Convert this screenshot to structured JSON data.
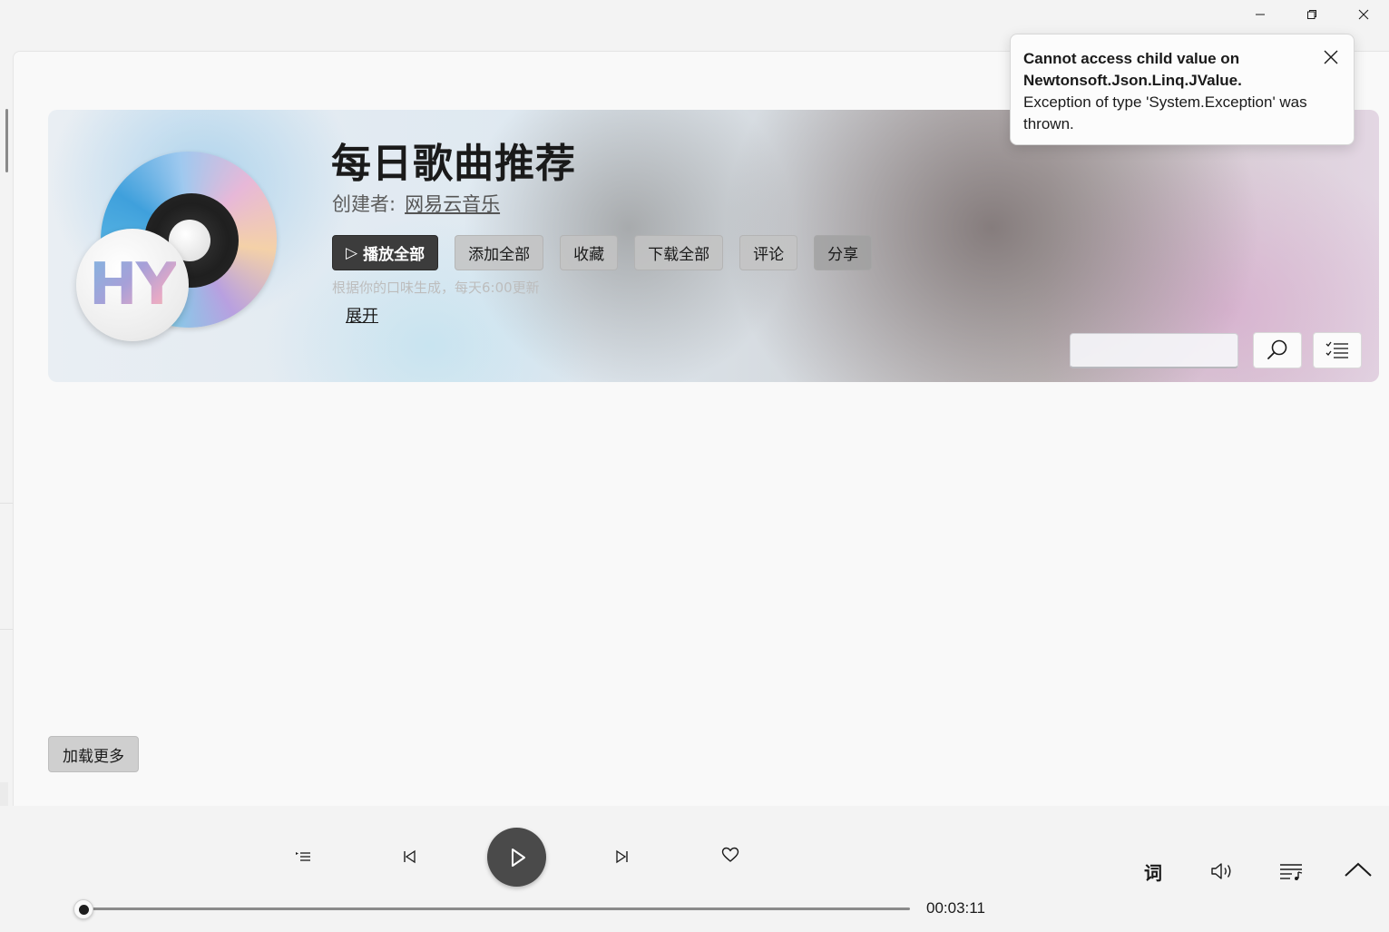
{
  "playlist": {
    "title": "每日歌曲推荐",
    "creator_label": "创建者:",
    "creator_name": "网易云音乐",
    "description": "根据你的口味生成，每天6:00更新",
    "expand_label": "展开",
    "badge_text": "HY"
  },
  "actions": {
    "play_all_icon": "▷",
    "play_all": "播放全部",
    "add_all": "添加全部",
    "favorite": "收藏",
    "download_all": "下载全部",
    "comments": "评论",
    "share": "分享"
  },
  "search": {
    "value": "",
    "placeholder": ""
  },
  "toast": {
    "title": "Cannot access child value on Newtonsoft.Json.Linq.JValue.",
    "message": "Exception of type 'System.Exception' was thrown."
  },
  "load_more": "加载更多",
  "player": {
    "time": "00:03:11",
    "lyrics_label": "词",
    "progress": 0.0
  },
  "icons": {
    "window": [
      "minimize-icon",
      "restore-icon",
      "close-icon"
    ],
    "player": [
      "playlist-icon",
      "previous-icon",
      "play-icon",
      "next-icon",
      "heart-icon",
      "volume-icon",
      "queue-icon",
      "chevron-up-icon"
    ],
    "banner": [
      "search-icon",
      "list-icon"
    ]
  }
}
